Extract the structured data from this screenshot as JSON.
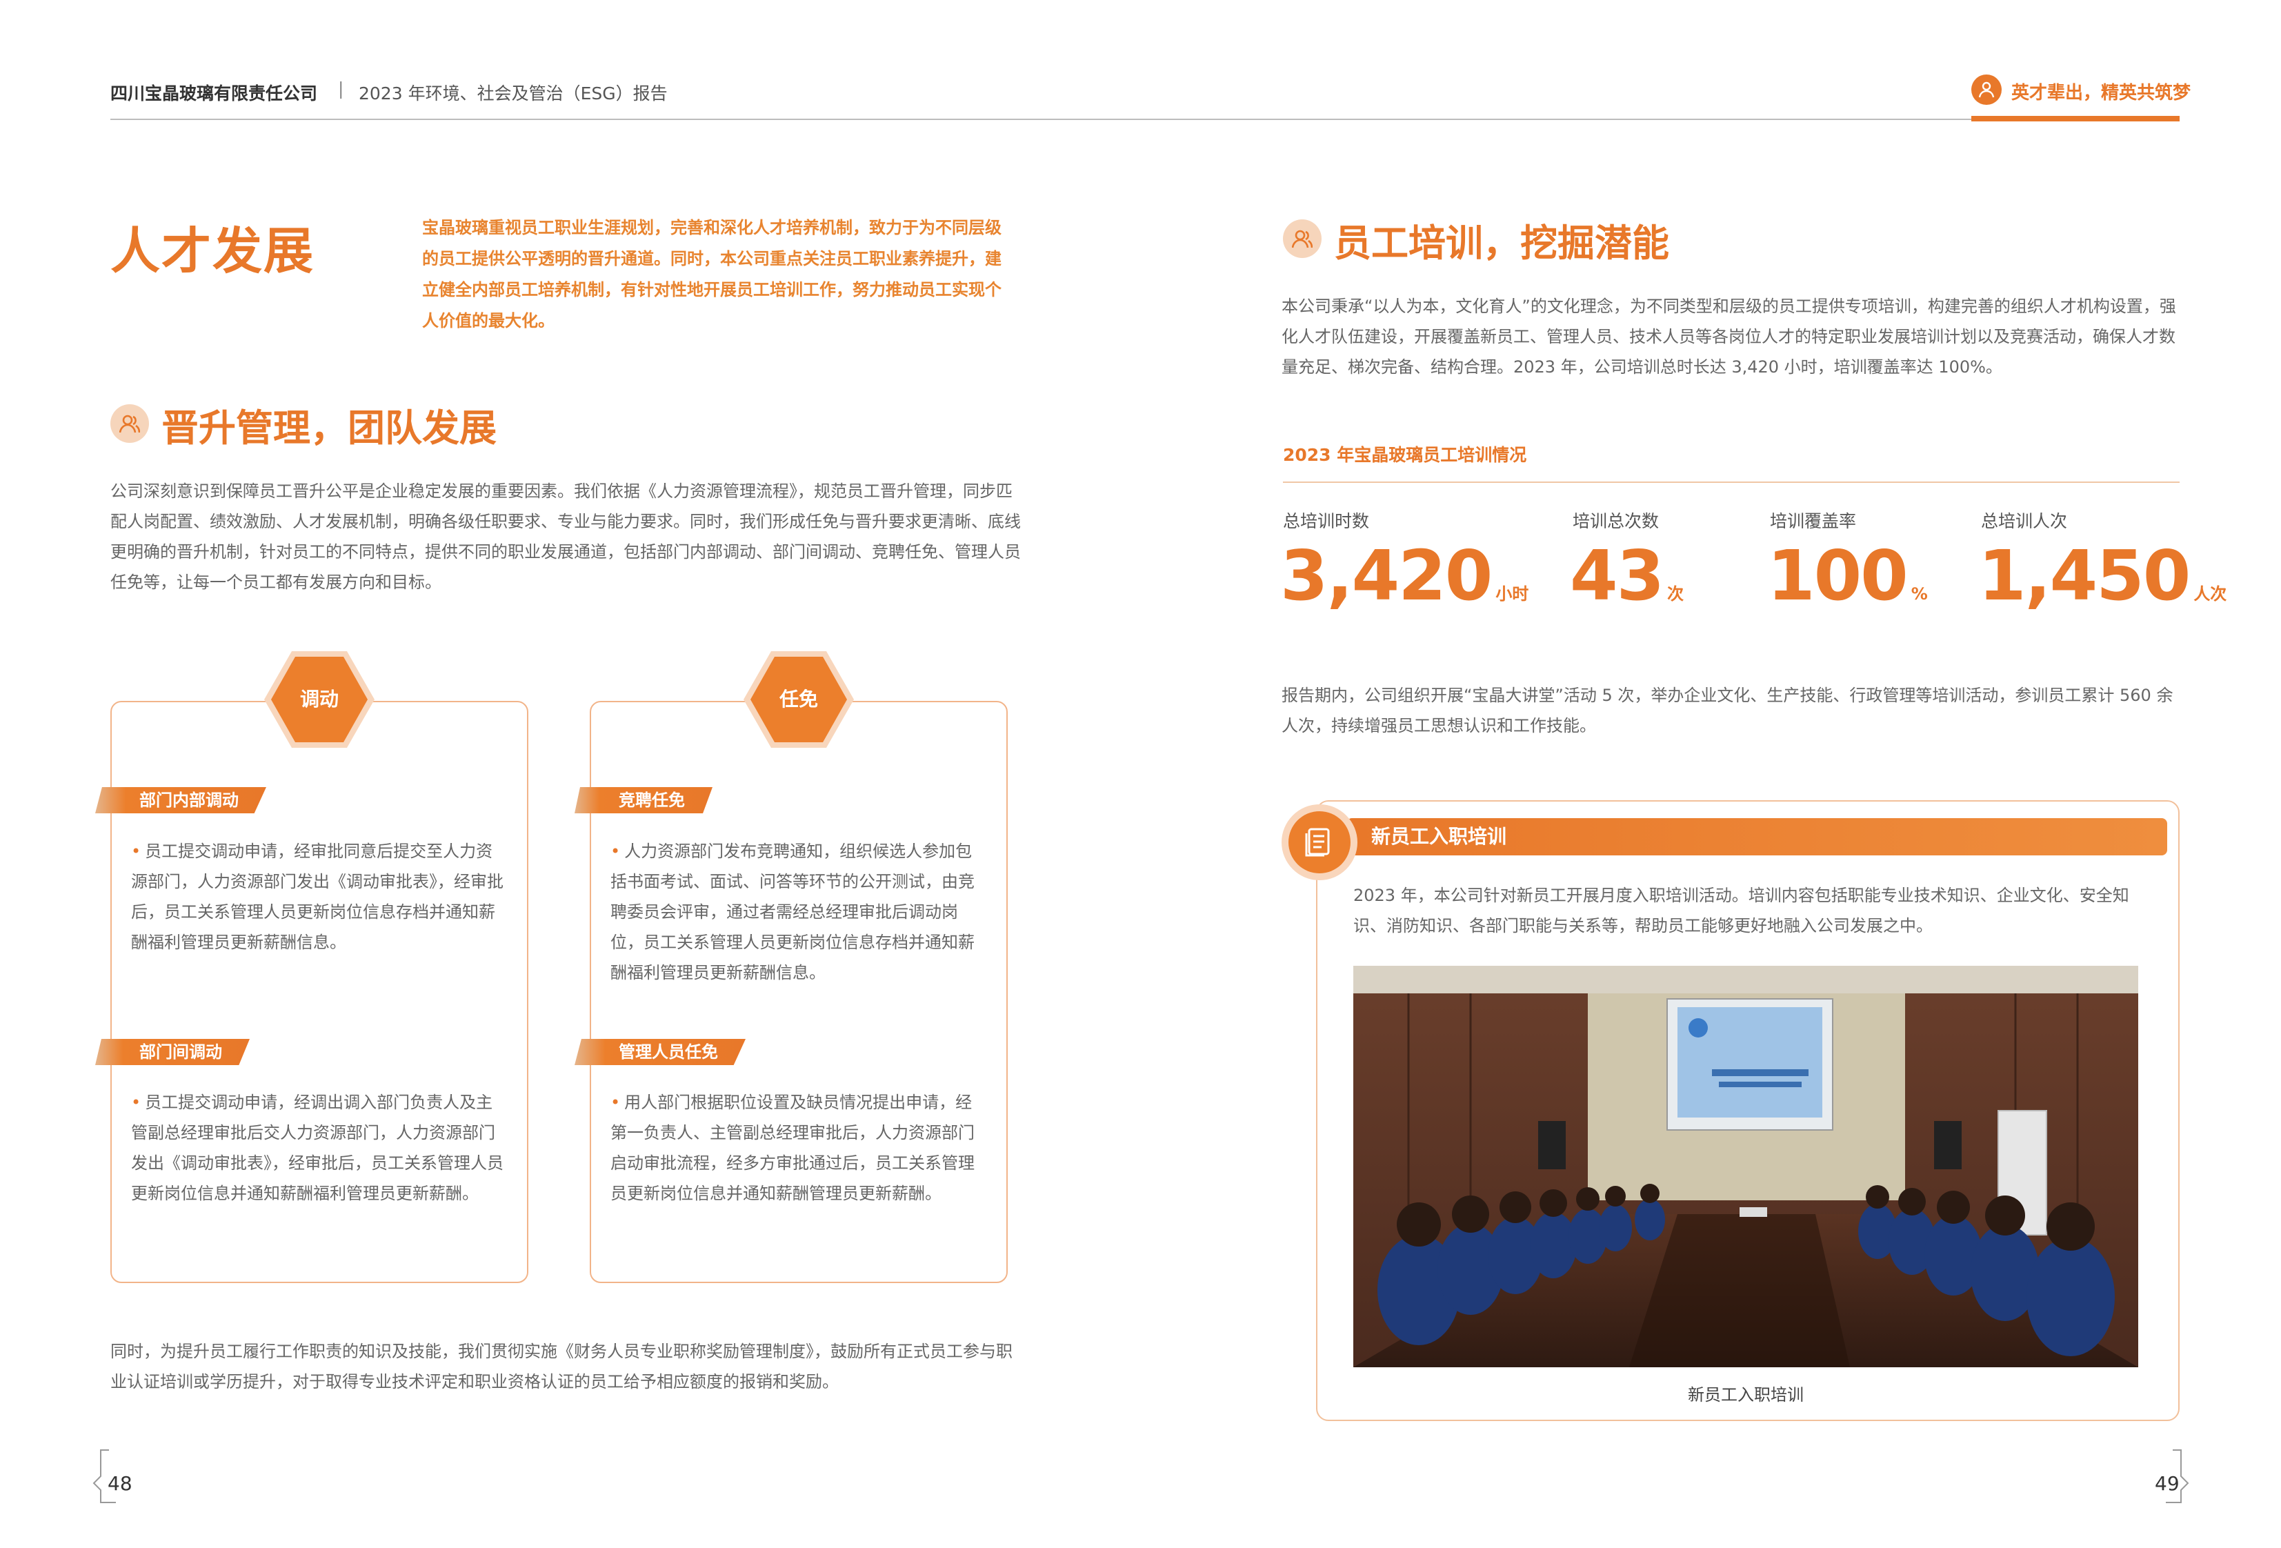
{
  "header": {
    "company": "四川宝晶玻璃有限责任公司",
    "separator": "|",
    "report": "2023 年环境、社会及管治（ESG）报告",
    "slogan": "英才辈出，精英共筑梦",
    "slogan_icon": "people-icon",
    "accent_color": "#e8782a"
  },
  "left": {
    "title": "人才发展",
    "intro": "宝晶玻璃重视员工职业生涯规划，完善和深化人才培养机制，致力于为不同层级的员工提供公平透明的晋升通道。同时，本公司重点关注员工职业素养提升，建立健全内部员工培养机制，有针对性地开展员工培训工作，努力推动员工实现个人价值的最大化。",
    "section_title": "晋升管理，团队发展",
    "section_body": "公司深刻意识到保障员工晋升公平是企业稳定发展的重要因素。我们依据《人力资源管理流程》，规范员工晋升管理，同步匹配人岗配置、绩效激励、人才发展机制，明确各级任职要求、专业与能力要求。同时，我们形成任免与晋升要求更清晰、底线更明确的晋升机制，针对员工的不同特点，提供不同的职业发展通道，包括部门内部调动、部门间调动、竞聘任免、管理人员任免等，让每一个员工都有发展方向和目标。",
    "cards": [
      {
        "hex_label": "调动",
        "items": [
          {
            "tag": "部门内部调动",
            "text": "员工提交调动申请，经审批同意后提交至人力资源部门，人力资源部门发出《调动审批表》，经审批后，员工关系管理人员更新岗位信息存档并通知薪酬福利管理员更新薪酬信息。"
          },
          {
            "tag": "部门间调动",
            "text": "员工提交调动申请，经调出调入部门负责人及主管副总经理审批后交人力资源部门，人力资源部门发出《调动审批表》，经审批后，员工关系管理人员更新岗位信息并通知薪酬福利管理员更新薪酬。"
          }
        ]
      },
      {
        "hex_label": "任免",
        "items": [
          {
            "tag": "竞聘任免",
            "text": "人力资源部门发布竞聘通知，组织候选人参加包括书面考试、面试、问答等环节的公开测试，由竞聘委员会评审，通过者需经总经理审批后调动岗位，员工关系管理人员更新岗位信息存档并通知薪酬福利管理员更新薪酬信息。"
          },
          {
            "tag": "管理人员任免",
            "text": "用人部门根据职位设置及缺员情况提出申请，经第一负责人、主管副总经理审批后，人力资源部门启动审批流程，经多方审批通过后，员工关系管理员更新岗位信息并通知薪酬管理员更新薪酬。"
          }
        ]
      }
    ],
    "closing": "同时，为提升员工履行工作职责的知识及技能，我们贯彻实施《财务人员专业职称奖励管理制度》，鼓励所有正式员工参与职业认证培训或学历提升，对于取得专业技术评定和职业资格认证的员工给予相应额度的报销和奖励。",
    "page_number": "48"
  },
  "right": {
    "section_title": "员工培训，挖掘潜能",
    "section_body": "本公司秉承“以人为本，文化育人”的文化理念，为不同类型和层级的员工提供专项培训，构建完善的组织人才机构设置，强化人才队伍建设，开展覆盖新员工、管理人员、技术人员等各岗位人才的特定职业发展培训计划以及竞赛活动，确保人才数量充足、梯次完备、结构合理。2023 年，公司培训总时长达 3,420 小时，培训覆盖率达 100%。",
    "stats_title": "2023 年宝晶玻璃员工培训情况",
    "stats": [
      {
        "label": "总培训时数",
        "value": "3,420",
        "unit": "小时"
      },
      {
        "label": "培训总次数",
        "value": "43",
        "unit": "次"
      },
      {
        "label": "培训覆盖率",
        "value": "100",
        "unit": "%"
      },
      {
        "label": "总培训人次",
        "value": "1,450",
        "unit": "人次"
      }
    ],
    "activity": "报告期内，公司组织开展“宝晶大讲堂”活动 5 次，举办企业文化、生产技能、行政管理等培训活动，参训员工累计 560 余人次，持续增强员工思想认识和工作技能。",
    "training_box": {
      "title": "新员工入职培训",
      "icon": "document-icon",
      "body": "2023 年，本公司针对新员工开展月度入职培训活动。培训内容包括职能专业技术知识、企业文化、安全知识、消防知识、各部门职能与关系等，帮助员工能够更好地融入公司发展之中。",
      "caption": "新员工入职培训"
    },
    "page_number": "49"
  }
}
